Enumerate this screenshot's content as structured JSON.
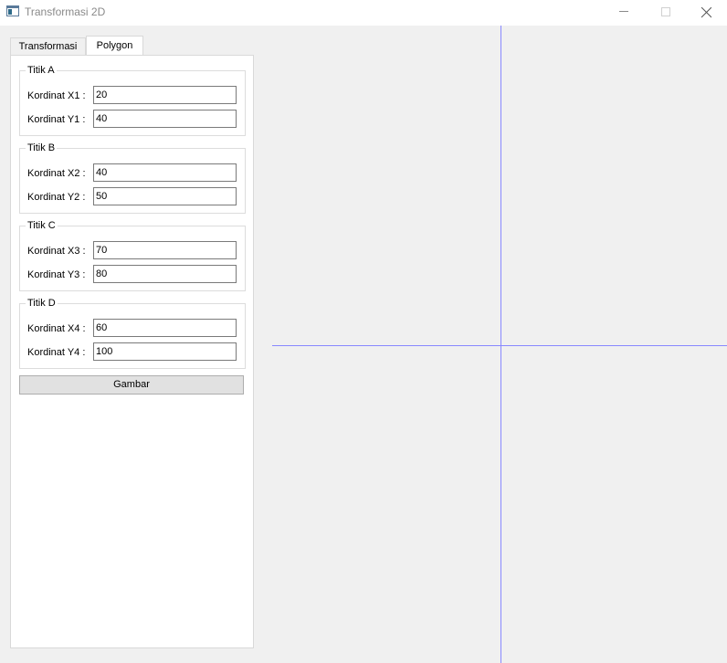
{
  "window": {
    "title": "Transformasi 2D"
  },
  "tabs": [
    {
      "label": "Transformasi",
      "active": false
    },
    {
      "label": "Polygon",
      "active": true
    }
  ],
  "groups": [
    {
      "title": "Titik A",
      "fields": [
        {
          "label": "Kordinat X1 :",
          "value": "20"
        },
        {
          "label": "Kordinat Y1 :",
          "value": "40"
        }
      ]
    },
    {
      "title": "Titik B",
      "fields": [
        {
          "label": "Kordinat X2 :",
          "value": "40"
        },
        {
          "label": "Kordinat Y2 :",
          "value": "50"
        }
      ]
    },
    {
      "title": "Titik C",
      "fields": [
        {
          "label": "Kordinat X3 :",
          "value": "70"
        },
        {
          "label": "Kordinat Y3 :",
          "value": "80"
        }
      ]
    },
    {
      "title": "Titik D",
      "fields": [
        {
          "label": "Kordinat X4 :",
          "value": "60"
        },
        {
          "label": "Kordinat Y4 :",
          "value": "100"
        }
      ]
    }
  ],
  "gambar_button": "Gambar",
  "colors": {
    "axis": "#8888ff",
    "window_bg": "#f0f0f0"
  }
}
